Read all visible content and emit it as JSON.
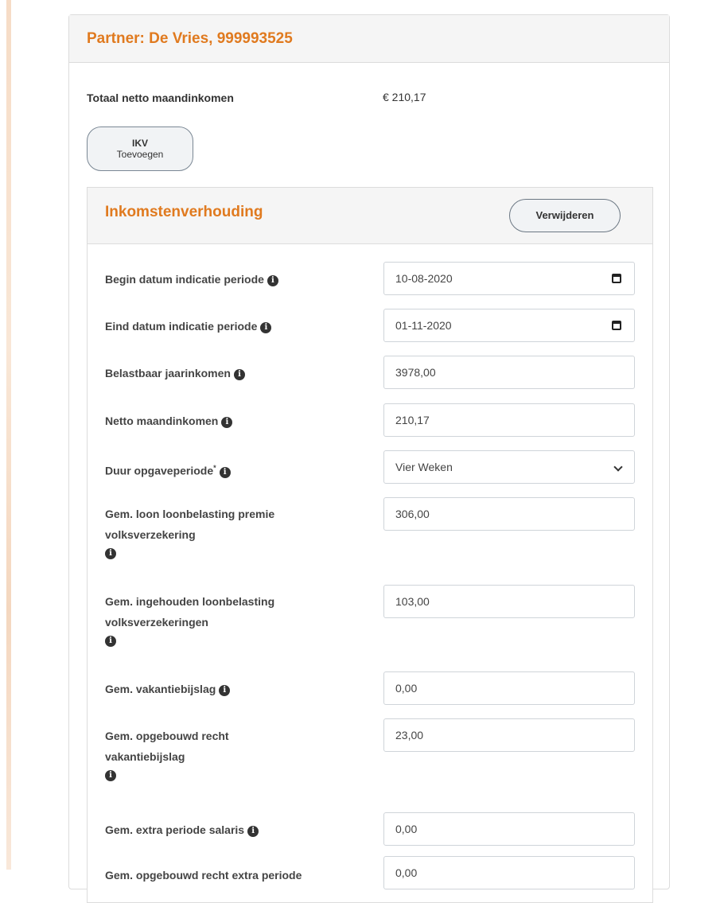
{
  "partner": {
    "title": "Partner: De Vries, 999993525"
  },
  "total": {
    "label": "Totaal netto maandinkomen",
    "value": "€ 210,17"
  },
  "ikv_button": {
    "line1": "IKV",
    "line2": "Toevoegen"
  },
  "section": {
    "title": "Inkomstenverhouding",
    "remove_label": "Verwijderen"
  },
  "fields": {
    "begin": {
      "label": "Begin datum indicatie periode",
      "value": "10-08-2020"
    },
    "eind": {
      "label": "Eind datum indicatie periode",
      "value": "01-11-2020"
    },
    "belastbaar": {
      "label": "Belastbaar jaarinkomen",
      "value": "3978,00"
    },
    "netto": {
      "label": "Netto maandinkomen",
      "value": "210,17"
    },
    "duur": {
      "label": "Duur opgaveperiode",
      "required": "*",
      "value": "Vier Weken"
    },
    "gem_loon": {
      "label": "Gem. loon loonbelasting premie volksverzekering",
      "value": "306,00"
    },
    "gem_ingehouden": {
      "label": "Gem. ingehouden loonbelasting volksverzekeringen",
      "value": "103,00"
    },
    "gem_vakantie": {
      "label": "Gem. vakantiebijslag",
      "value": "0,00"
    },
    "gem_opgebouwd": {
      "label": "Gem. opgebouwd recht vakantiebijslag",
      "value": "23,00"
    },
    "gem_extra": {
      "label": "Gem. extra periode salaris",
      "value": "0,00"
    },
    "gem_opgebouwd_extra": {
      "label": "Gem. opgebouwd recht extra periode",
      "value": "0,00"
    }
  },
  "icons": {
    "info": "i",
    "calendar": "calendar-icon",
    "chevron": "chevron-down-icon"
  },
  "colors": {
    "accent": "#e07a1f",
    "header_bg": "#f5f5f5"
  }
}
